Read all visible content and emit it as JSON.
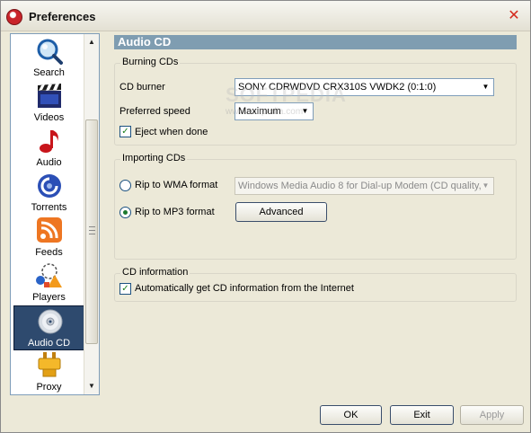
{
  "window": {
    "title": "Preferences",
    "app_icon": "app-logo-icon",
    "close_icon": "close-icon",
    "close_symbol": "✕"
  },
  "sidebar": {
    "items": [
      {
        "label": "Search",
        "icon": "search-icon"
      },
      {
        "label": "Videos",
        "icon": "clapperboard-icon"
      },
      {
        "label": "Audio",
        "icon": "music-note-icon"
      },
      {
        "label": "Torrents",
        "icon": "torrent-icon"
      },
      {
        "label": "Feeds",
        "icon": "rss-feed-icon"
      },
      {
        "label": "Players",
        "icon": "players-icon"
      },
      {
        "label": "Audio CD",
        "icon": "cd-icon",
        "selected": true
      },
      {
        "label": "Proxy",
        "icon": "plug-icon"
      }
    ],
    "scroll_up_symbol": "▲",
    "scroll_down_symbol": "▼"
  },
  "main": {
    "header_title": "Audio CD",
    "burning": {
      "legend": "Burning CDs",
      "cd_burner_label": "CD burner",
      "cd_burner_value": "SONY    CDRWDVD CRX310S  VWDK2 (0:1:0)",
      "preferred_speed_label": "Preferred speed",
      "preferred_speed_value": "Maximum",
      "eject_label": "Eject when done",
      "eject_checked": true
    },
    "importing": {
      "legend": "Importing CDs",
      "wma_label": "Rip to WMA format",
      "wma_format_value": "Windows Media Audio 8 for Dial-up Modem (CD quality,",
      "mp3_label": "Rip to MP3 format",
      "mp3_selected": true,
      "advanced_label": "Advanced"
    },
    "cd_info": {
      "legend": "CD information",
      "auto_label": "Automatically get CD information from the Internet",
      "auto_checked": true
    },
    "check_mark": "✓",
    "dropdown_arrow": "▼"
  },
  "footer": {
    "ok_label": "OK",
    "exit_label": "Exit",
    "apply_label": "Apply"
  },
  "watermark": {
    "text": "SOFTPEDIA",
    "sub": "www.softpedia.com"
  }
}
